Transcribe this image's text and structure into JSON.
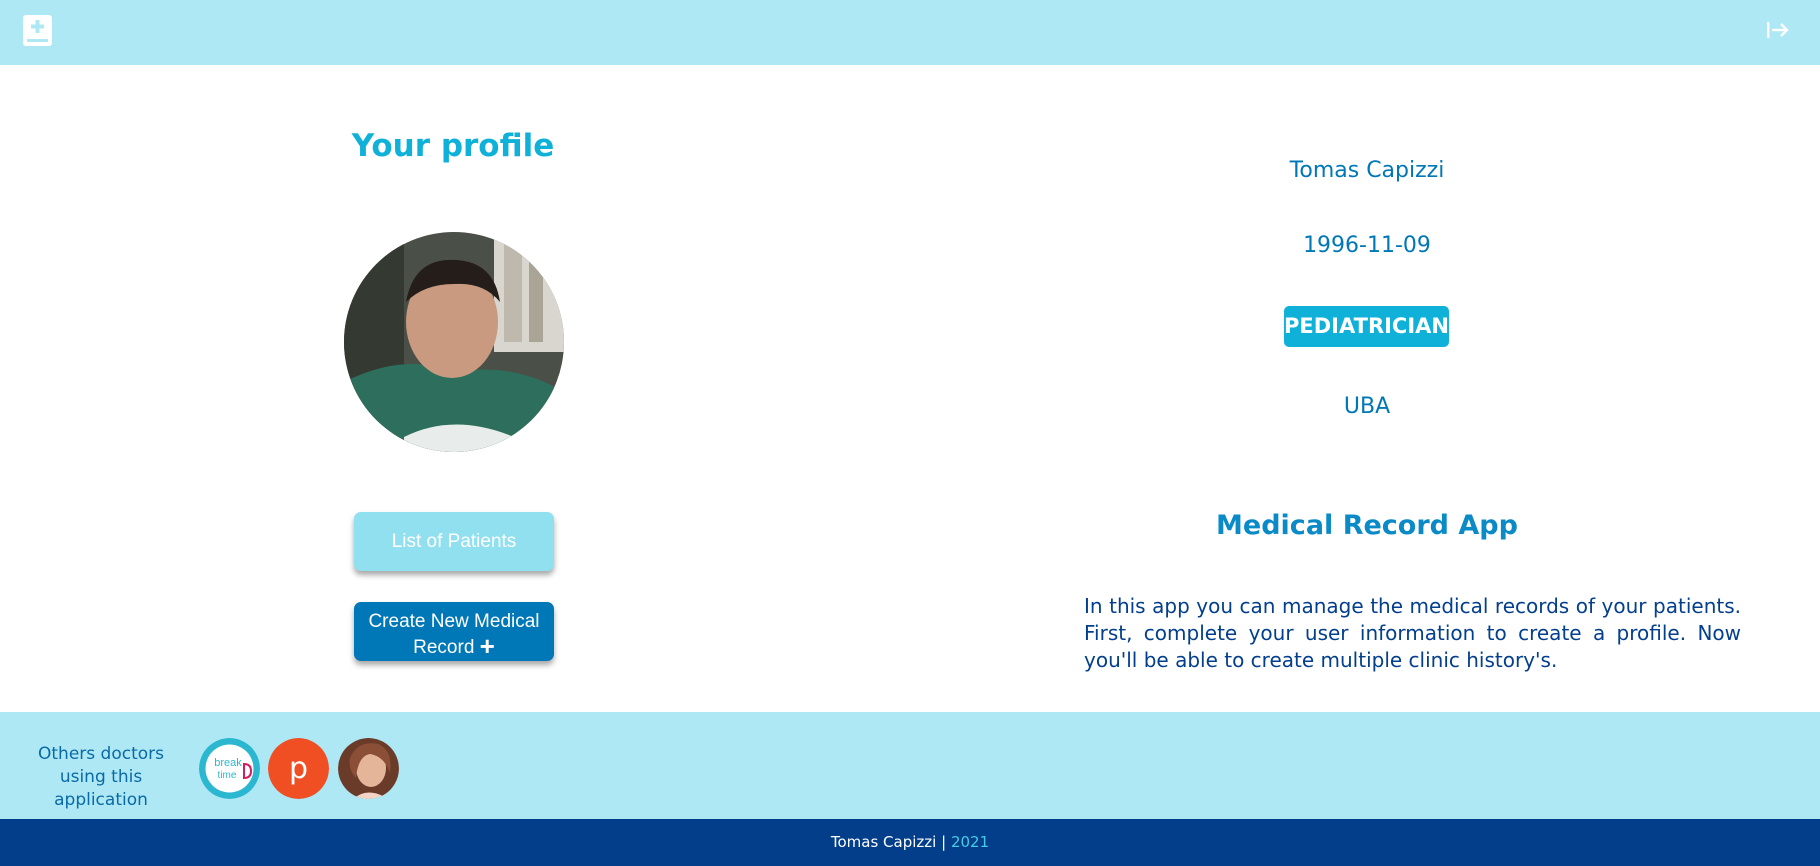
{
  "header": {
    "logo_icon": "medical-book-icon",
    "logout_icon": "logout-arrow-icon"
  },
  "profile": {
    "title": "Your profile",
    "name": "Tomas Capizzi",
    "birthdate": "1996-11-09",
    "specialty": "PEDIATRICIAN",
    "institution": "UBA"
  },
  "actions": {
    "list_patients_label": "List of Patients",
    "create_record_label": "Create New Medical Record",
    "create_record_icon": "plus-icon"
  },
  "app_info": {
    "title": "Medical Record App",
    "description": "In this app you can manage the medical records of your patients. First, complete your user information to create a profile. Now you'll be able to create multiple clinic history's."
  },
  "others": {
    "label": "Others doctors using this application",
    "doctors": [
      {
        "logo_text_1": "break",
        "logo_text_2": "time"
      },
      {
        "logo_text": "p"
      },
      {}
    ]
  },
  "footer": {
    "author": "Tomas Capizzi",
    "separator": "|",
    "year": "2021"
  },
  "colors": {
    "header_bg": "#ade8f4",
    "accent": "#0fb1d8",
    "primary_button": "#0077b6",
    "secondary_button": "#90e0ef",
    "footer_bg": "#023e8a"
  }
}
